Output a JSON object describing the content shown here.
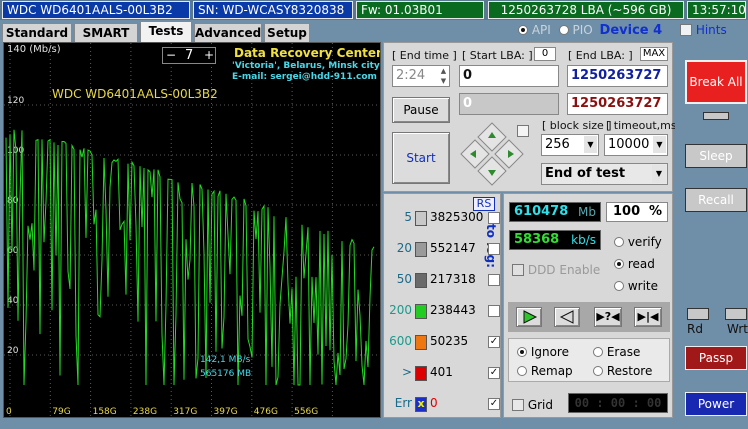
{
  "topbar": {
    "model": "WDC WD6401AALS-00L3B2",
    "serial": "SN: WD-WCASY8320838",
    "firmware": "Fw: 01.03B01",
    "lba": "1250263728 LBA (~596 GB)",
    "clock": "13:57:10"
  },
  "tabs": [
    {
      "label": "Standard",
      "active": false
    },
    {
      "label": "SMART",
      "active": false
    },
    {
      "label": "Tests",
      "active": true
    },
    {
      "label": "Advanced",
      "active": false
    },
    {
      "label": "Setup",
      "active": false
    }
  ],
  "interface": {
    "api": "API",
    "pio": "PIO",
    "device": "Device 4",
    "hints": "Hints"
  },
  "graph": {
    "unit": "140 (Mb/s)",
    "drive_label": "WDC WD6401AALS-00L3B2",
    "stepper_minus": "−",
    "stepper_value": "7",
    "stepper_plus": "+",
    "center_title": "Data Recovery Center:",
    "center_line2": "'Victoria', Belarus, Minsk city",
    "center_line3": "E-mail: sergei@hdd-911.com",
    "speed_readout": "142,1 MB/s",
    "position_readout": "565176 MB",
    "y_ticks": [
      "120",
      "100",
      "80",
      "60",
      "40",
      "20"
    ],
    "x_ticks": [
      "0",
      "79G",
      "158G",
      "238G",
      "317G",
      "397G",
      "476G",
      "556G"
    ],
    "line_color": "#22dd22",
    "grid_color": "#5a5a5a",
    "label_color": "#e8d84a"
  },
  "controls": {
    "end_time_label": "[ End time ]",
    "end_time_value": "2:24",
    "start_lba_label": "[ Start LBA: ]",
    "start_lba_zero": "0",
    "start_lba_value": "0",
    "current_value": "0",
    "end_lba_label": "[ End LBA: ]",
    "end_lba_max": "MAX",
    "end_lba_value": "1250263727",
    "end_lba_value2": "1250263727",
    "pause_label": "Pause",
    "start_label": "Start",
    "block_size_label": "[ block size ]",
    "block_size_value": "256",
    "timeout_label": "[ timeout,ms ]",
    "timeout_value": "10000",
    "end_mode_value": "End of test"
  },
  "histogram": {
    "rs_label": "RS",
    "to_log_label": "to log:",
    "rows": [
      {
        "threshold": "5",
        "count": "3825300",
        "color": "#c8c8c8",
        "checked": false
      },
      {
        "threshold": "20",
        "count": "552147",
        "color": "#9a9a9a",
        "checked": false
      },
      {
        "threshold": "50",
        "count": "217318",
        "color": "#6a6a6a",
        "checked": false
      },
      {
        "threshold": "200",
        "count": "238443",
        "color": "#22cc22",
        "checked": false
      },
      {
        "threshold": "600",
        "count": "50235",
        "color": "#ee7711",
        "checked": true
      },
      {
        "threshold": ">",
        "count": "401",
        "color": "#dd0000",
        "checked": true
      },
      {
        "threshold": "Err",
        "count": "0",
        "color": "#1a2ec8",
        "checked": true
      }
    ]
  },
  "stats": {
    "mb_value": "610478",
    "mb_unit": "Mb",
    "percent_value": "100",
    "percent_unit": "%",
    "speed_value": "58368",
    "speed_unit": "kb/s",
    "ddd_label": "DDD Enable",
    "mode_verify": "verify",
    "mode_read": "read",
    "mode_write": "write",
    "action_ignore": "Ignore",
    "action_erase": "Erase",
    "action_remap": "Remap",
    "action_restore": "Restore",
    "grid_label": "Grid",
    "timer_value": "00 : 00 : 00"
  },
  "side": {
    "break_all": "Break All",
    "sleep": "Sleep",
    "recall": "Recall",
    "rd": "Rd",
    "wrt": "Wrt",
    "passp": "Passp",
    "power": "Power"
  }
}
